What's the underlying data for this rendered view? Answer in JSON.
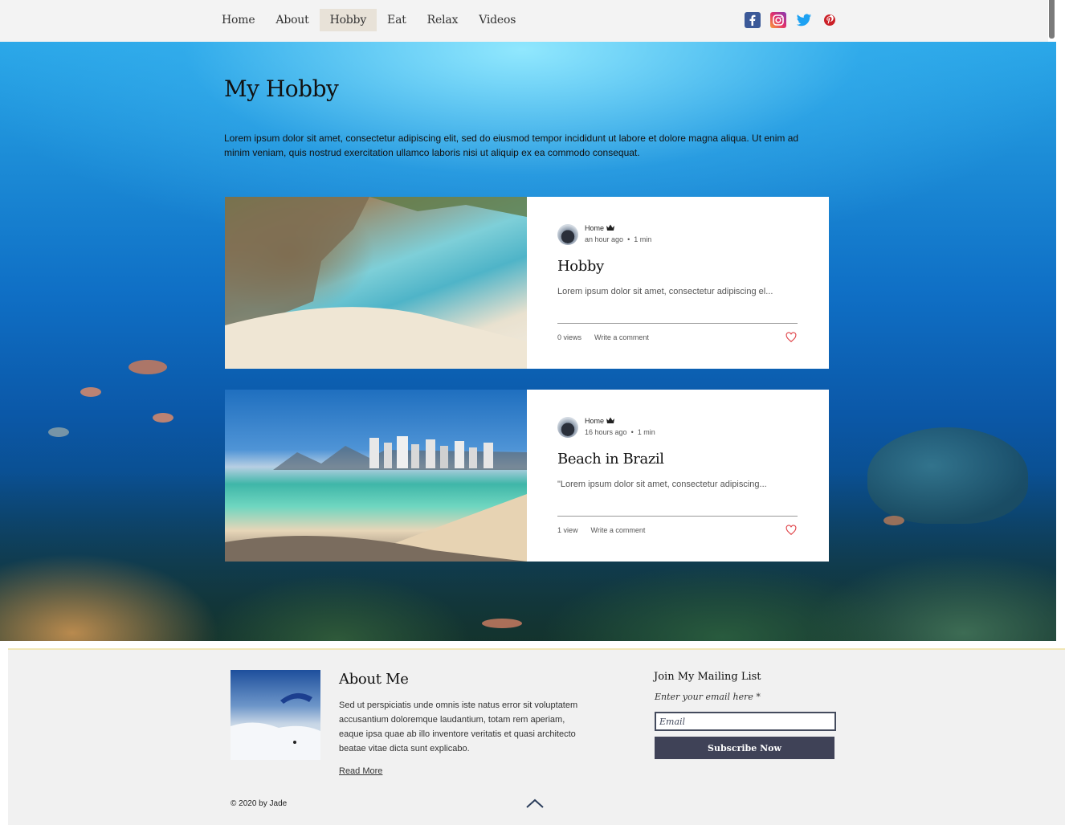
{
  "nav": {
    "items": [
      {
        "label": "Home"
      },
      {
        "label": "About"
      },
      {
        "label": "Hobby"
      },
      {
        "label": "Eat"
      },
      {
        "label": "Relax"
      },
      {
        "label": "Videos"
      }
    ],
    "active": "Hobby"
  },
  "social": [
    "facebook-icon",
    "instagram-icon",
    "twitter-icon",
    "pinterest-icon"
  ],
  "hero": {
    "title": "My Hobby",
    "description": "Lorem ipsum dolor sit amet, consectetur adipiscing elit, sed do eiusmod tempor incididunt ut labore et dolore magna aliqua. Ut enim ad minim veniam, quis nostrud exercitation ullamco laboris nisi ut aliquip ex ea commodo consequat."
  },
  "posts": [
    {
      "author": "Home",
      "time": "an hour ago",
      "read": "1 min",
      "title": "Hobby",
      "excerpt": "Lorem ipsum dolor sit amet, consectetur adipiscing el...",
      "views": "0 views",
      "comment": "Write a comment"
    },
    {
      "author": "Home",
      "time": "16 hours ago",
      "read": "1 min",
      "title": "Beach in Brazil",
      "excerpt": "\"Lorem ipsum dolor sit amet, consectetur adipiscing...",
      "views": "1 view",
      "comment": "Write a comment"
    }
  ],
  "footer": {
    "about_title": "About Me",
    "about_text": "Sed ut perspiciatis unde omnis iste natus error sit voluptatem accusantium doloremque laudantium, totam rem aperiam, eaque ipsa quae ab illo inventore veritatis et quasi architecto beatae vitae dicta sunt explicabo.",
    "read_more": "Read More",
    "mail_title": "Join My Mailing List",
    "email_label": "Enter your email here *",
    "email_placeholder": "Email",
    "subscribe": "Subscribe Now",
    "copyright": "© 2020 by Jade"
  },
  "colors": {
    "header_bg": "#f3f3f3",
    "nav_active_bg": "#e8e2d8",
    "button_bg": "#3f4257",
    "heart": "#e0474c"
  }
}
